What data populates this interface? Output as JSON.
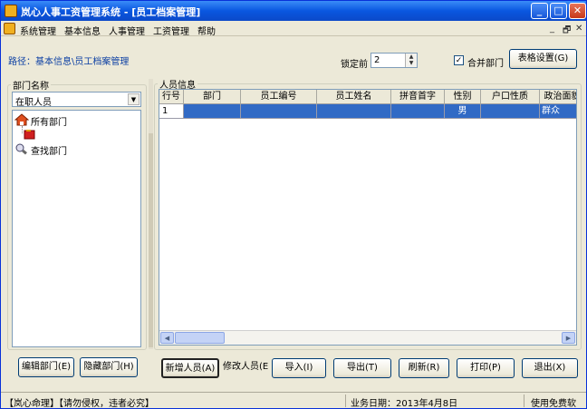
{
  "window": {
    "title": "岚心人事工资管理系统 - [员工档案管理]",
    "controls": {
      "minimize": "_",
      "maximize": "□",
      "close": "✕"
    }
  },
  "menu": {
    "items": [
      "系统管理",
      "基本信息",
      "人事管理",
      "工资管理",
      "帮助"
    ],
    "mdi_controls": [
      "_",
      "🗗",
      "✕"
    ]
  },
  "path": "路径：基本信息\\员工档案管理",
  "toolbar": {
    "lock_label": "锁定前",
    "lock_value": "2",
    "merge_check": "✓",
    "merge_label": "合并部门",
    "table_settings": "表格设置(G)"
  },
  "left": {
    "group_title": "部门名称",
    "combo_value": "在职人员",
    "tree": [
      "所有部门",
      "查找部门"
    ],
    "edit_dept": "编辑部门(E)",
    "hide_dept": "隐藏部门(H)"
  },
  "right": {
    "group_title": "人员信息",
    "columns": [
      "行号",
      "部门",
      "员工编号",
      "员工姓名",
      "拼音首字",
      "性别",
      "户口性质",
      "政治面貌"
    ],
    "rows": [
      [
        "1",
        "",
        "",
        "",
        "",
        "男",
        "",
        "群众"
      ]
    ]
  },
  "actions": {
    "add": "新增人员(A)",
    "modify": "修改人员(E",
    "import": "导入(I)",
    "export": "导出(T)",
    "refresh": "刷新(R)",
    "print": "打印(P)",
    "exit": "退出(X)"
  },
  "status": {
    "left": "【岚心命理】【请勿侵权，违者必究】",
    "date": "业务日期：2013年4月8日",
    "right": "使用免费软"
  },
  "colors": {
    "title_bar": "#0a57e0",
    "selection": "#316ac5",
    "path_text": "#0b3fa3"
  }
}
